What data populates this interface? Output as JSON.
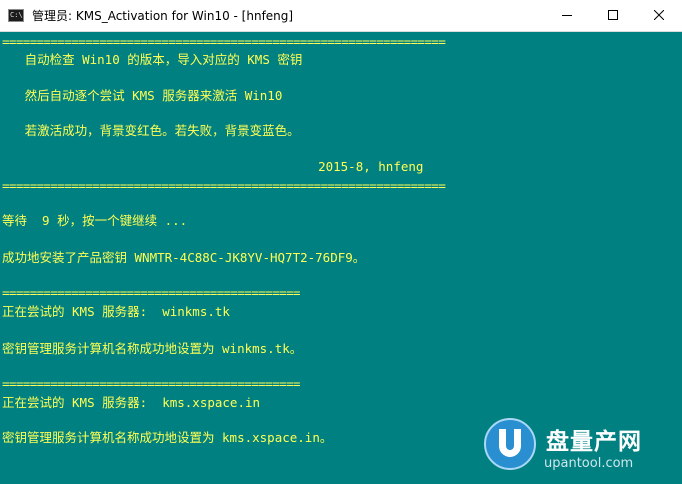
{
  "window": {
    "icon_label": "C:\\.",
    "title": "管理员:  KMS_Activation for Win10 - [hnfeng]",
    "controls": [
      "minimize",
      "maximize",
      "close"
    ]
  },
  "colors": {
    "console_background": "#008080",
    "console_text": "#ffff55"
  },
  "console": {
    "lines": [
      "================================================================",
      "   自动检查 Win10 的版本，导入对应的 KMS 密钥",
      "   然后自动逐个尝试 KMS 服务器来激活 Win10",
      "   若激活成功，背景变红色。若失败，背景变蓝色。",
      "                                          2015-8, hnfeng",
      "================================================================",
      "等待  9 秒，按一个键继续 ...",
      "成功地安装了产品密钥 WNMTR-4C88C-JK8YV-HQ7T2-76DF9。",
      "===========================================",
      "正在尝试的 KMS 服务器:  winkms.tk",
      "密钥管理服务计算机名称成功地设置为 winkms.tk。",
      "===========================================",
      "正在尝试的 KMS 服务器:  kms.xspace.in",
      "密钥管理服务计算机名称成功地设置为 kms.xspace.in。"
    ]
  },
  "watermark": {
    "brand": "盘量产网",
    "site": "upantool.com"
  }
}
